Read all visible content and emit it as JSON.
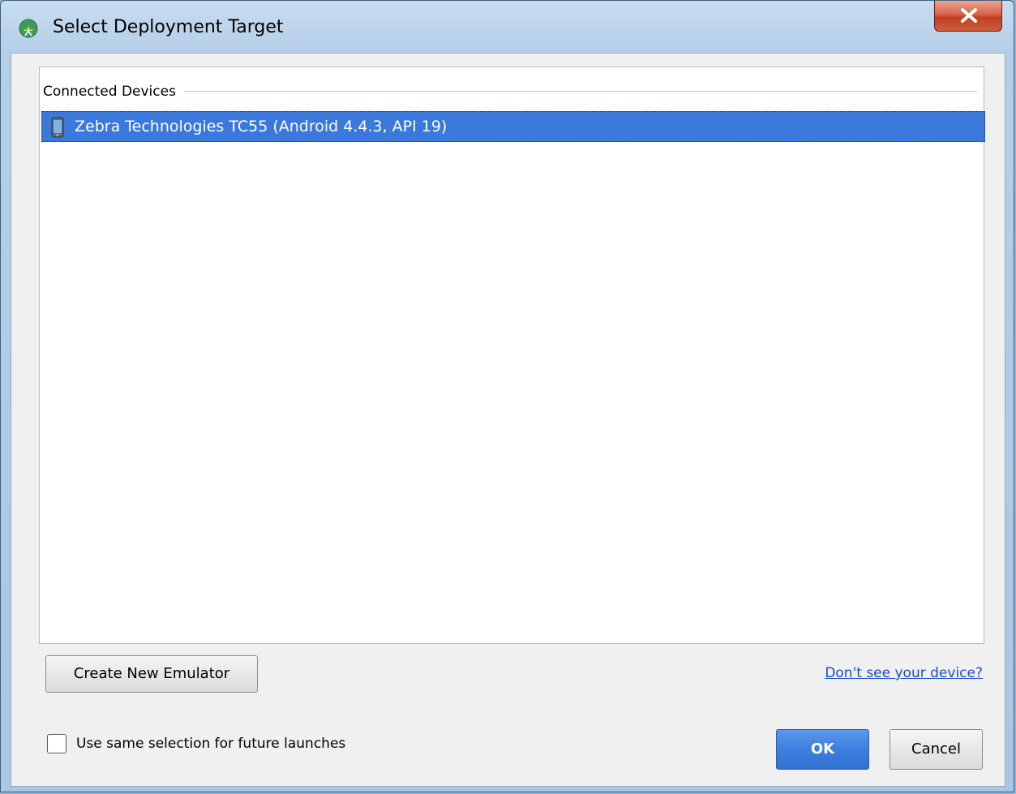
{
  "window": {
    "title": "Select Deployment Target",
    "close_label": "X"
  },
  "devices": {
    "section_title": "Connected Devices",
    "items": [
      {
        "label": "Zebra Technologies TC55 (Android 4.4.3, API 19)",
        "selected": true
      }
    ]
  },
  "actions": {
    "create_emulator_label": "Create New Emulator",
    "help_link": "Don't see your device?",
    "remember_label": "Use same selection for future launches",
    "remember_checked": false,
    "ok_label": "OK",
    "cancel_label": "Cancel"
  },
  "colors": {
    "selection": "#3b78dc",
    "link": "#1a4cd0",
    "primary_button": "#3d7fde"
  },
  "icons": {
    "app": "android-studio-icon",
    "device": "phone-icon",
    "close": "close-icon"
  }
}
